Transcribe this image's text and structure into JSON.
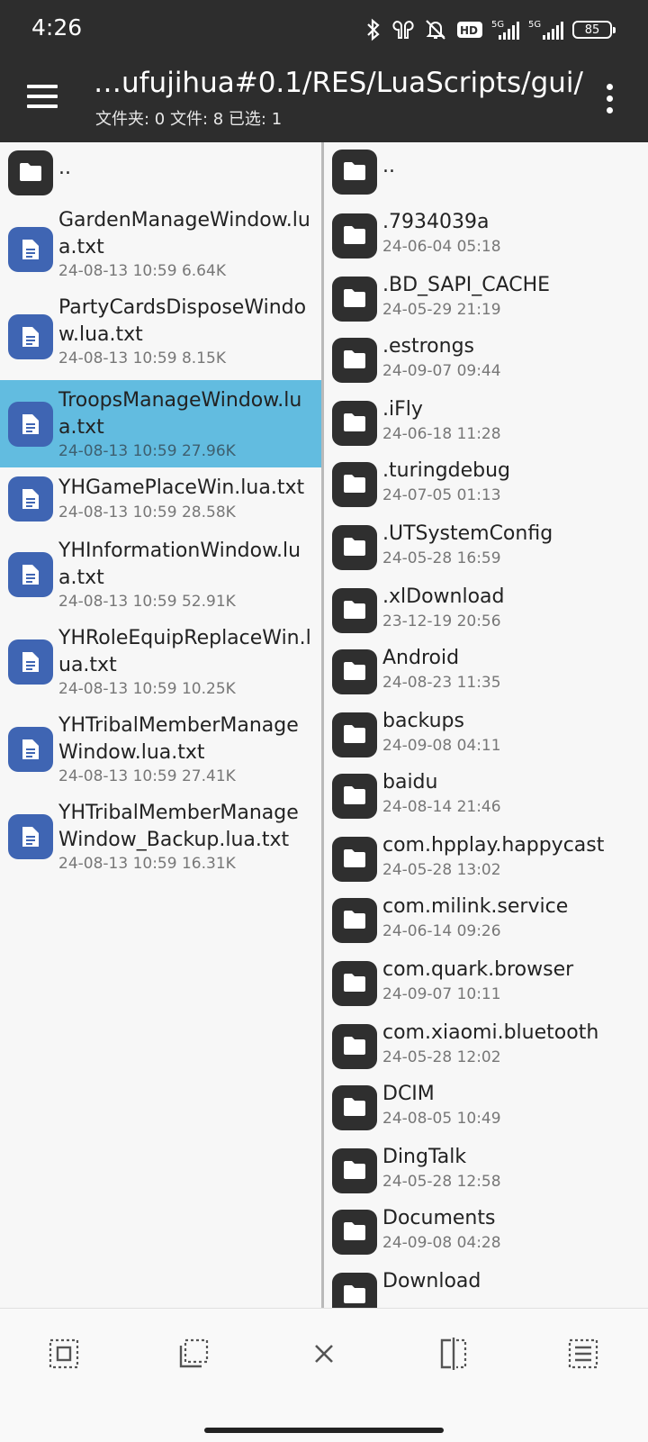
{
  "status_bar": {
    "time": "4:26",
    "hd_label": "HD",
    "net1": "5G",
    "net2": "5G",
    "battery": "85"
  },
  "header": {
    "path": "…ufujihua#0.1/RES/LuaScripts/gui/",
    "summary": "文件夹: 0  文件: 8  已选: 1"
  },
  "left_pane": {
    "items": [
      {
        "name": "..",
        "meta": "",
        "type": "folder",
        "selected": false
      },
      {
        "name": "GardenManageWindow.lua.txt",
        "meta": "24-08-13 10:59  6.64K",
        "type": "doc",
        "selected": false
      },
      {
        "name": "PartyCardsDisposeWindow.lua.txt",
        "meta": "24-08-13 10:59  8.15K",
        "type": "doc",
        "selected": false
      },
      {
        "name": "TroopsManageWindow.lua.txt",
        "meta": "24-08-13 10:59  27.96K",
        "type": "doc",
        "selected": true
      },
      {
        "name": "YHGamePlaceWin.lua.txt",
        "meta": "24-08-13 10:59  28.58K",
        "type": "doc",
        "selected": false
      },
      {
        "name": "YHInformationWindow.lua.txt",
        "meta": "24-08-13 10:59  52.91K",
        "type": "doc",
        "selected": false
      },
      {
        "name": "YHRoleEquipReplaceWin.lua.txt",
        "meta": "24-08-13 10:59  10.25K",
        "type": "doc",
        "selected": false
      },
      {
        "name": "YHTribalMemberManageWindow.lua.txt",
        "meta": "24-08-13 10:59  27.41K",
        "type": "doc",
        "selected": false
      },
      {
        "name": "YHTribalMemberManageWindow_Backup.lua.txt",
        "meta": "24-08-13 10:59  16.31K",
        "type": "doc",
        "selected": false
      }
    ]
  },
  "right_pane": {
    "items": [
      {
        "name": "..",
        "meta": ""
      },
      {
        "name": ".7934039a",
        "meta": "24-06-04 05:18"
      },
      {
        "name": ".BD_SAPI_CACHE",
        "meta": "24-05-29 21:19"
      },
      {
        "name": ".estrongs",
        "meta": "24-09-07 09:44"
      },
      {
        "name": ".iFly",
        "meta": "24-06-18 11:28"
      },
      {
        "name": ".turingdebug",
        "meta": "24-07-05 01:13"
      },
      {
        "name": ".UTSystemConfig",
        "meta": "24-05-28 16:59"
      },
      {
        "name": ".xlDownload",
        "meta": "23-12-19 20:56"
      },
      {
        "name": "Android",
        "meta": "24-08-23 11:35"
      },
      {
        "name": "backups",
        "meta": "24-09-08 04:11"
      },
      {
        "name": "baidu",
        "meta": "24-08-14 21:46"
      },
      {
        "name": "com.hpplay.happycast",
        "meta": "24-05-28 13:02"
      },
      {
        "name": "com.milink.service",
        "meta": "24-06-14 09:26"
      },
      {
        "name": "com.quark.browser",
        "meta": "24-09-07 10:11"
      },
      {
        "name": "com.xiaomi.bluetooth",
        "meta": "24-05-28 12:02"
      },
      {
        "name": "DCIM",
        "meta": "24-08-05 10:49"
      },
      {
        "name": "DingTalk",
        "meta": "24-05-28 12:58"
      },
      {
        "name": "Documents",
        "meta": "24-09-08 04:28"
      },
      {
        "name": "Download",
        "meta": ""
      }
    ]
  },
  "toolbar": {
    "buttons": [
      "select-all-icon",
      "select-range-icon",
      "close-icon",
      "split-view-icon",
      "list-view-icon"
    ]
  },
  "colors": {
    "topbar": "#2d2d2d",
    "selected_row": "#62bce0",
    "doc_icon": "#3f65b3",
    "folder_icon": "#2f2f2f"
  }
}
